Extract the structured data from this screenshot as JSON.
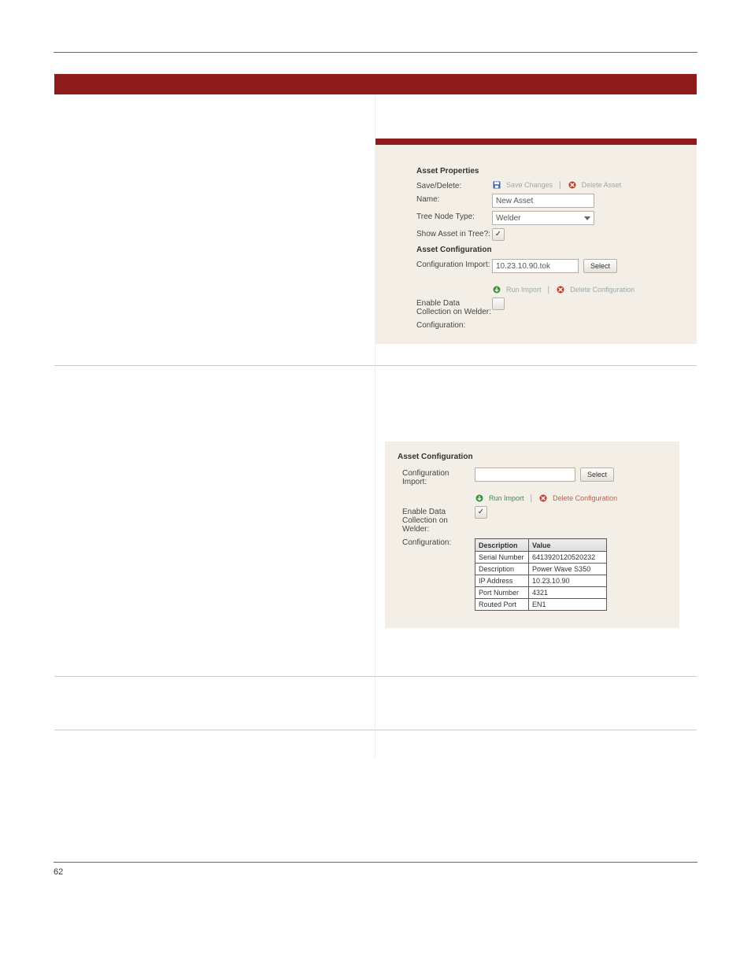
{
  "pageNumber": "62",
  "panel1": {
    "title": "Asset Properties",
    "saveDeleteLabel": "Save/Delete:",
    "saveChanges": "Save Changes",
    "deleteAsset": "Delete Asset",
    "nameLabel": "Name:",
    "nameValue": "New Asset",
    "treeNodeLabel": "Tree Node Type:",
    "treeNodeValue": "Welder",
    "showInTreeLabel": "Show Asset in Tree?:",
    "cfgTitle": "Asset Configuration",
    "cfgImportLabel": "Configuration Import:",
    "cfgImportValue": "10.23.10.90.tok",
    "selectBtn": "Select",
    "runImport": "Run Import",
    "deleteConfig": "Delete Configuration",
    "enableDataLabel": "Enable Data Collection on Welder:",
    "configLabel": "Configuration:"
  },
  "panel2": {
    "title": "Asset Configuration",
    "cfgImportLabel": "Configuration Import:",
    "selectBtn": "Select",
    "runImport": "Run Import",
    "deleteConfig": "Delete Configuration",
    "enableDataLabel": "Enable Data Collection on Welder:",
    "configLabel": "Configuration:",
    "table": {
      "col1": "Description",
      "col2": "Value",
      "rows": [
        {
          "k": "Serial Number",
          "v": "6413920120520232"
        },
        {
          "k": "Description",
          "v": "Power Wave S350"
        },
        {
          "k": "IP Address",
          "v": "10.23.10.90"
        },
        {
          "k": "Port Number",
          "v": "4321"
        },
        {
          "k": "Routed Port",
          "v": "EN1"
        }
      ]
    }
  }
}
